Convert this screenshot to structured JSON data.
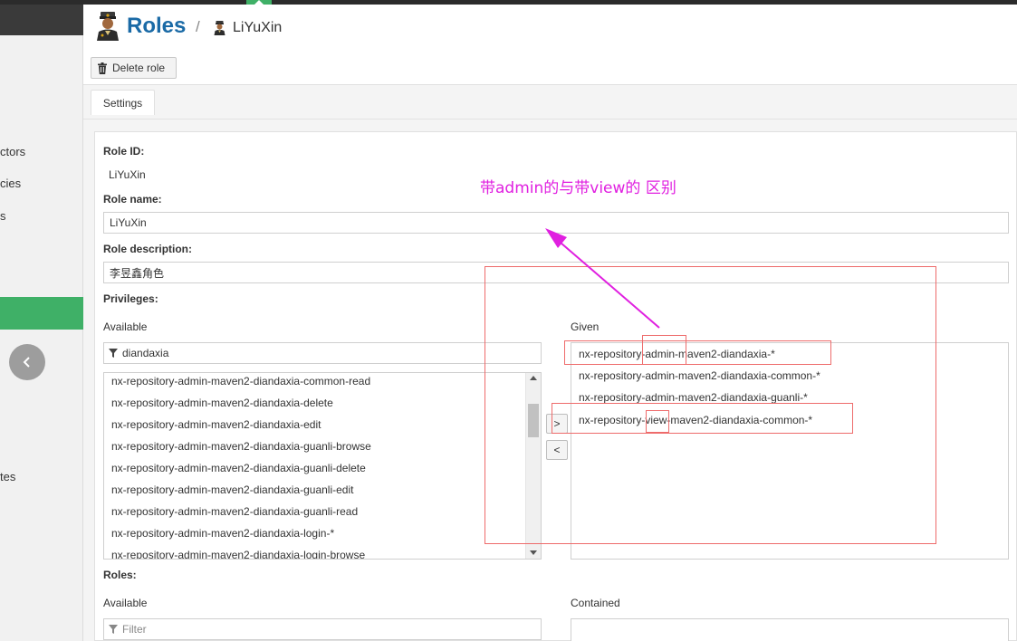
{
  "sidebar": {
    "items": [
      {
        "label": "ctors",
        "top": 0
      },
      {
        "label": "cies",
        "top": 0
      },
      {
        "label": "s",
        "top": 0
      },
      {
        "label": "tes",
        "top": 0
      }
    ]
  },
  "header": {
    "title": "Roles",
    "separator": "/",
    "breadcrumb_name": "LiYuXin"
  },
  "toolbar": {
    "delete_label": "Delete role"
  },
  "tabs": [
    {
      "label": "Settings"
    }
  ],
  "form": {
    "role_id_label": "Role ID:",
    "role_id_value": "LiYuXin",
    "role_name_label": "Role name:",
    "role_name_value": "LiYuXin",
    "role_description_label": "Role description:",
    "role_description_value": "李昱鑫角色",
    "privileges_label": "Privileges:",
    "roles_label": "Roles:"
  },
  "privileges": {
    "available_label": "Available",
    "given_label": "Given",
    "filter_value": "diandaxia",
    "available": [
      "nx-repository-admin-maven2-diandaxia-common-read",
      "nx-repository-admin-maven2-diandaxia-delete",
      "nx-repository-admin-maven2-diandaxia-edit",
      "nx-repository-admin-maven2-diandaxia-guanli-browse",
      "nx-repository-admin-maven2-diandaxia-guanli-delete",
      "nx-repository-admin-maven2-diandaxia-guanli-edit",
      "nx-repository-admin-maven2-diandaxia-guanli-read",
      "nx-repository-admin-maven2-diandaxia-login-*",
      "nx-repository-admin-maven2-diandaxia-login-browse"
    ],
    "given": [
      "nx-repository-admin-maven2-diandaxia-*",
      "nx-repository-admin-maven2-diandaxia-common-*",
      "nx-repository-admin-maven2-diandaxia-guanli-*",
      "nx-repository-view-maven2-diandaxia-common-*"
    ],
    "add_button": ">",
    "remove_button": "<"
  },
  "roles": {
    "available_label": "Available",
    "contained_label": "Contained",
    "filter_placeholder": "Filter"
  },
  "annotation": {
    "text": "带admin的与带view的 区别",
    "color": "#e020e0",
    "box_color": "#ee6b6b"
  },
  "colors": {
    "accent": "#3fb067",
    "title": "#1a6aa6"
  }
}
